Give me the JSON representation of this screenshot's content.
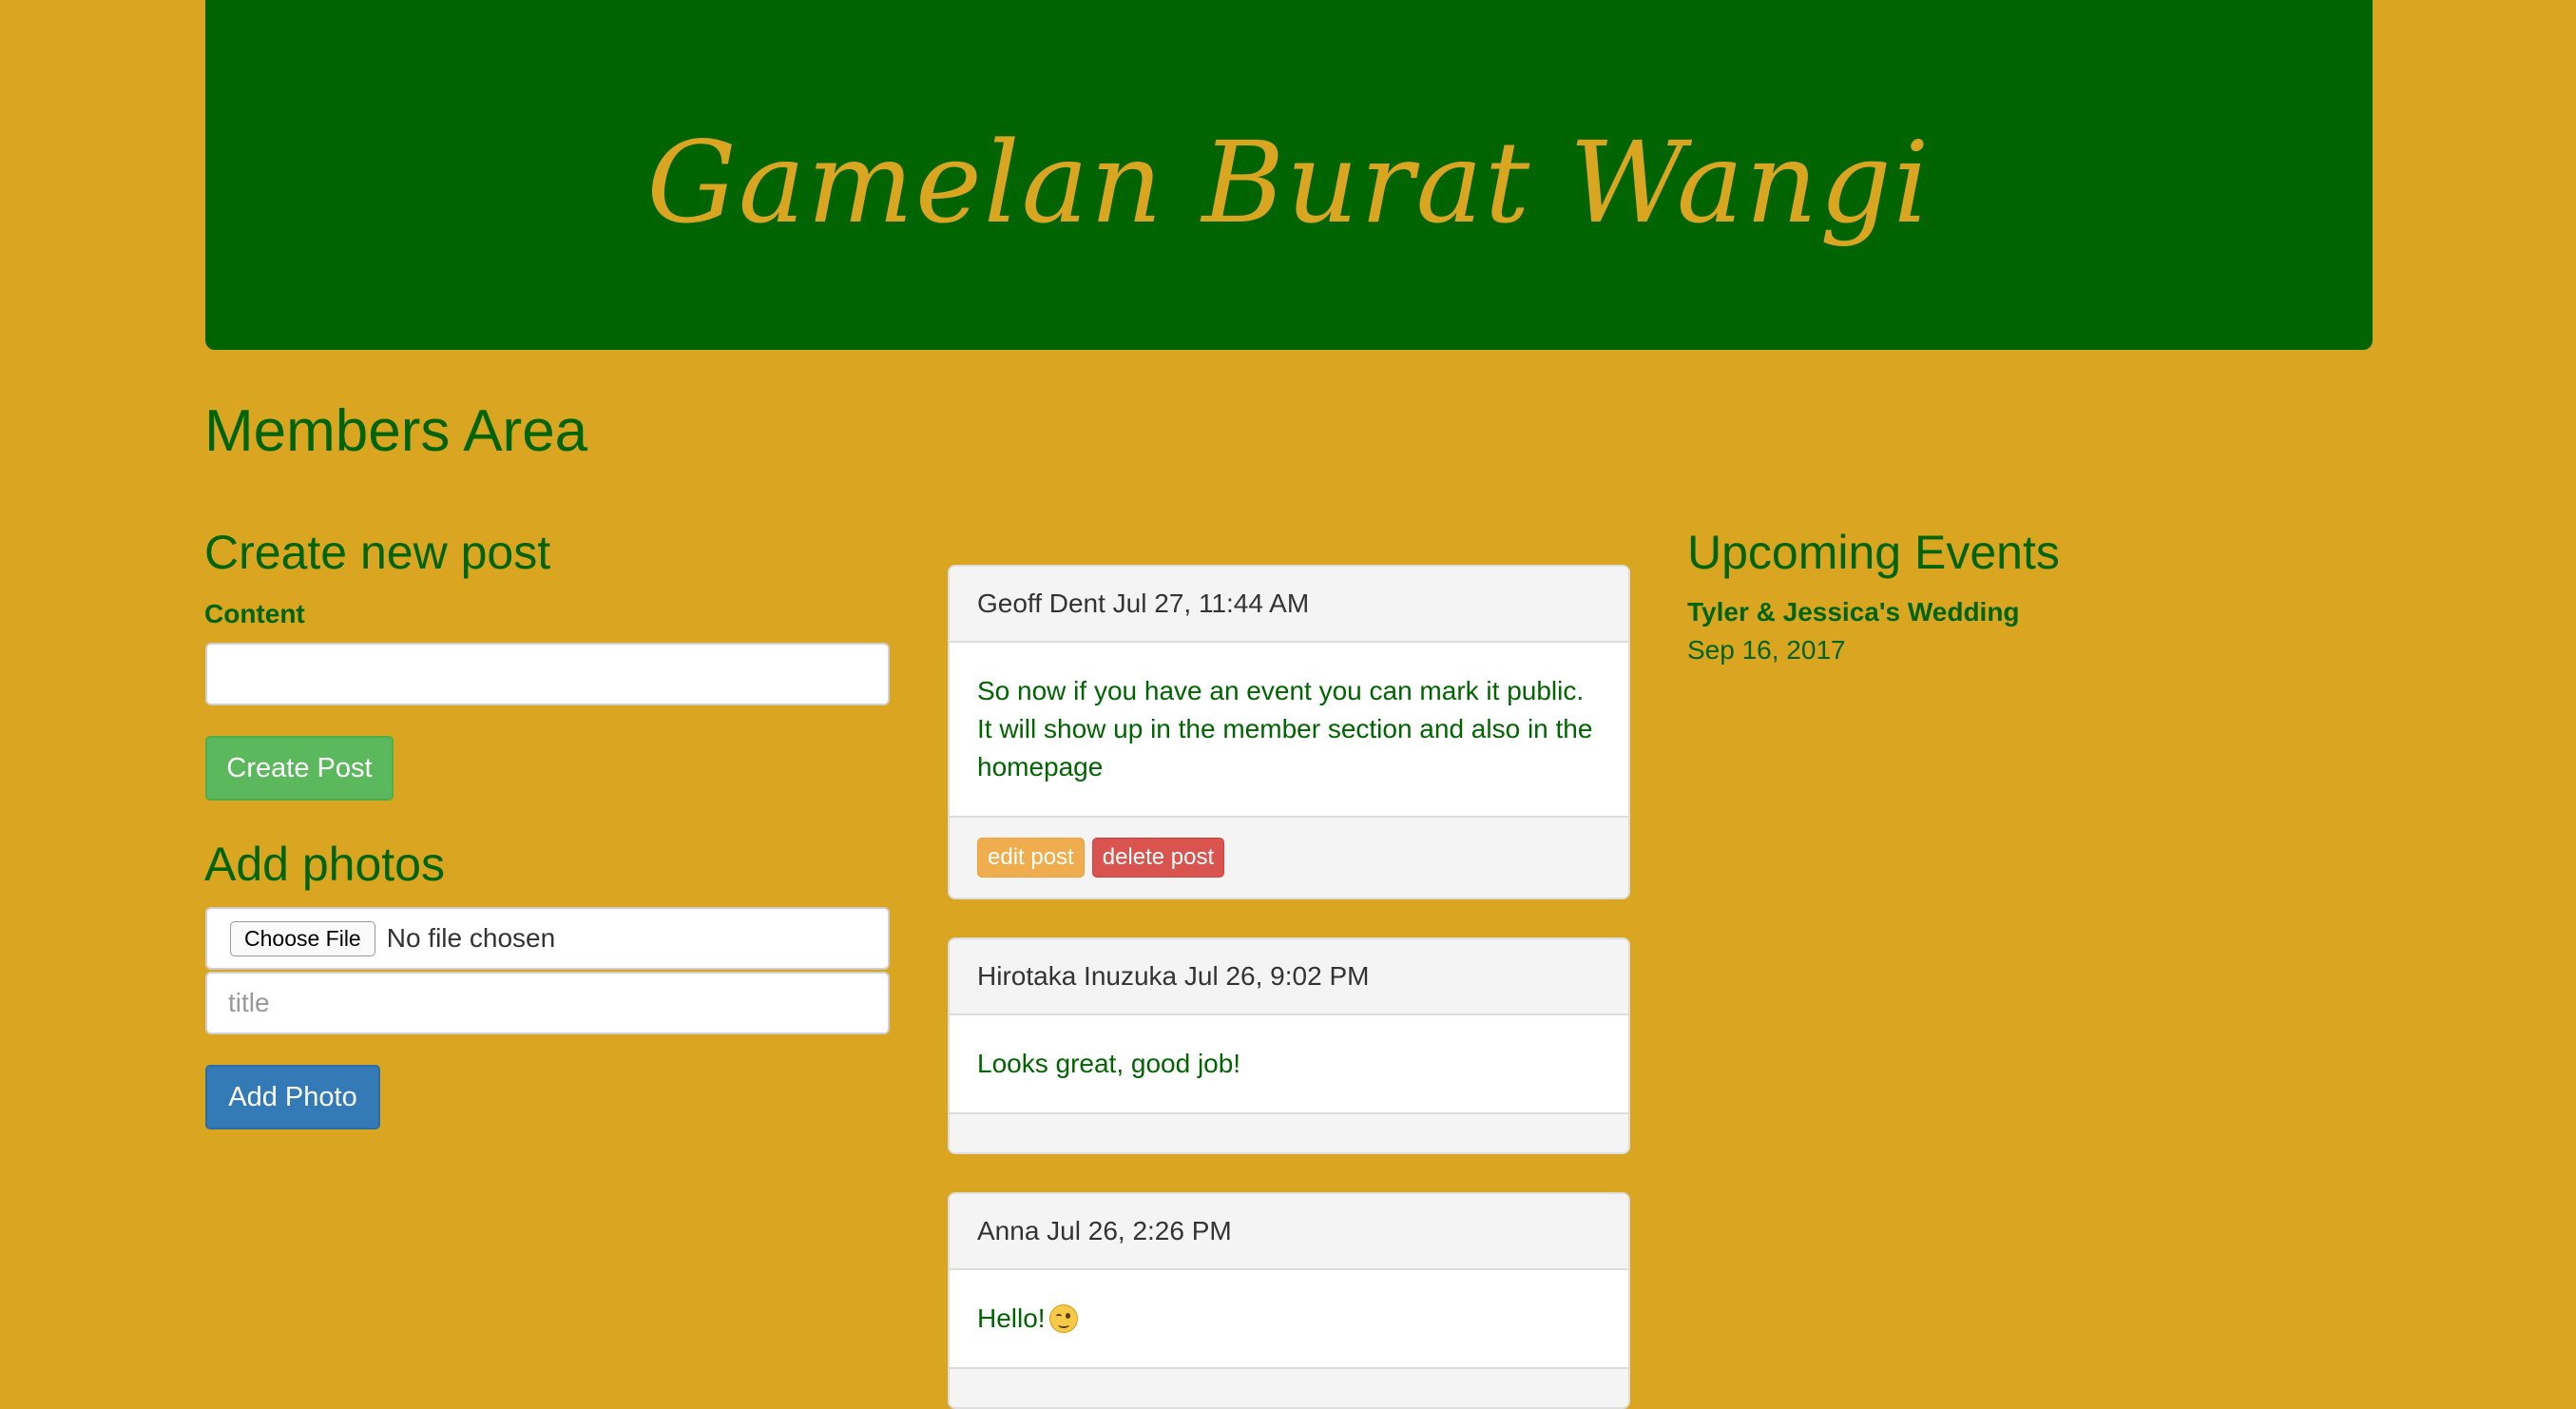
{
  "site": {
    "title": "Gamelan Burat Wangi"
  },
  "page_title": "Members Area",
  "create_post": {
    "heading": "Create new post",
    "content_label": "Content",
    "content_value": "",
    "button": "Create Post"
  },
  "photos": {
    "heading": "Add photos",
    "choose_file_label": "Choose File",
    "file_status": "No file chosen",
    "title_placeholder": "title",
    "button": "Add Photo"
  },
  "posts": [
    {
      "header": "Geoff Dent Jul 27, 11:44 AM",
      "body": "So now if you have an event you can mark it public. It will show up in the member section and also in the homepage",
      "edit_label": "edit post",
      "delete_label": "delete post"
    },
    {
      "header": "Hirotaka Inuzuka Jul 26, 9:02 PM",
      "body": "Looks great, good job!"
    },
    {
      "header": "Anna Jul 26, 2:26 PM",
      "body": "Hello!",
      "emoji": "winking-face-icon"
    }
  ],
  "events": {
    "heading": "Upcoming Events",
    "items": [
      {
        "name": "Tyler & Jessica's Wedding",
        "date": "Sep 16, 2017"
      }
    ]
  },
  "colors": {
    "background": "#daa520",
    "banner": "#006400",
    "text_green": "#006400",
    "btn_green": "#5cb85c",
    "btn_blue": "#337ab7",
    "btn_orange": "#f0ad4e",
    "btn_red": "#d9534f"
  }
}
